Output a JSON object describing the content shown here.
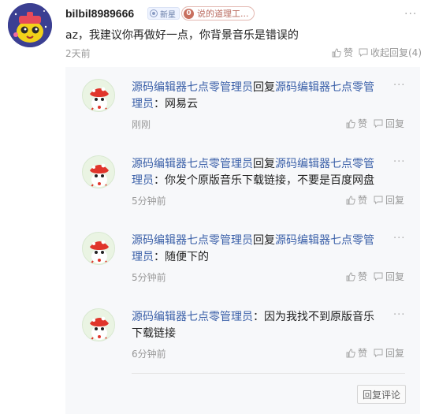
{
  "comment": {
    "username": "bilbil8989666",
    "badge_new": "新星",
    "medal_level": "0",
    "medal_text": "说的道理工...",
    "text": "az，我建议你再做好一点，你背景音乐是错误的",
    "time": "2天前",
    "like_label": "赞",
    "collapse_label": "收起回复(4)",
    "more": "···"
  },
  "replies": [
    {
      "user": "源码编辑器七点零管理员",
      "reply_word": "回复",
      "target": "源码编辑器七点零管理员",
      "content": "：网易云",
      "time": "刚刚",
      "like": "赞",
      "reply": "回复",
      "more": "···"
    },
    {
      "user": "源码编辑器七点零管理员",
      "reply_word": "回复",
      "target": "源码编辑器七点零管理员",
      "content": "：你发个原版音乐下载链接，不要是百度网盘",
      "time": "5分钟前",
      "like": "赞",
      "reply": "回复",
      "more": "···"
    },
    {
      "user": "源码编辑器七点零管理员",
      "reply_word": "回复",
      "target": "源码编辑器七点零管理员",
      "content": "：随便下的",
      "time": "5分钟前",
      "like": "赞",
      "reply": "回复",
      "more": "···"
    },
    {
      "user": "源码编辑器七点零管理员",
      "content": "：因为我找不到原版音乐下载链接",
      "time": "6分钟前",
      "like": "赞",
      "reply": "回复",
      "more": "···"
    }
  ],
  "reply_comment_button": "回复评论",
  "colors": {
    "link_blue": "#3a5fa8",
    "reply_bg": "#f7f8fa",
    "muted": "#999999"
  }
}
